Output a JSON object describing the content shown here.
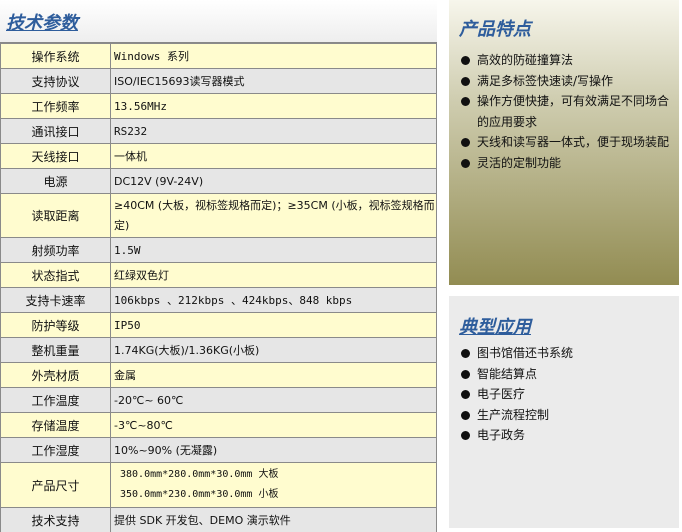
{
  "spec": {
    "title": "技术参数",
    "rows": [
      {
        "label": "操作系统",
        "value": "Windows 系列"
      },
      {
        "label": "支持协议",
        "value": "ISO/IEC15693读写器模式"
      },
      {
        "label": "工作频率",
        "value": "13.56MHz"
      },
      {
        "label": "通讯接口",
        "value": "RS232"
      },
      {
        "label": "天线接口",
        "value": "一体机"
      },
      {
        "label": "电源",
        "value": "DC12V (9V-24V)"
      },
      {
        "label": "读取距离",
        "value": "≥40CM (大板，视标签规格而定)；≥35CM  (小板，视标签规格而定)"
      },
      {
        "label": "射频功率",
        "value": "1.5W"
      },
      {
        "label": "状态指式",
        "value": "红绿双色灯"
      },
      {
        "label": "支持卡速率",
        "value": "106kbps 、212kbps 、424kbps、848 kbps"
      },
      {
        "label": "防护等级",
        "value": "IP50"
      },
      {
        "label": "整机重量",
        "value": "1.74KG(大板)/1.36KG(小板)"
      },
      {
        "label": "外壳材质",
        "value": "金属"
      },
      {
        "label": "工作温度",
        "value": "-20℃~ 60℃"
      },
      {
        "label": "存储温度",
        "value": "-3℃~80℃"
      },
      {
        "label": "工作湿度",
        "value": "10%~90% (无凝露)"
      },
      {
        "label": "产品尺寸",
        "value_line1": "380.0mm*280.0mm*30.0mm 大板",
        "value_line2": "350.0mm*230.0mm*30.0mm 小板"
      },
      {
        "label": "技术支持",
        "value": "提供 SDK 开发包、DEMO 演示软件"
      }
    ]
  },
  "features": {
    "title": "产品特点",
    "items": [
      "高效的防碰撞算法",
      "满足多标签快速读/写操作",
      "操作方便快捷，可有效满足不同场合的应用要求",
      "天线和读写器一体式，便于现场装配",
      "灵活的定制功能"
    ]
  },
  "applications": {
    "title": "典型应用",
    "items": [
      "图书馆借还书系统",
      "智能结算点",
      "电子医疗",
      "生产流程控制",
      "电子政务"
    ]
  }
}
